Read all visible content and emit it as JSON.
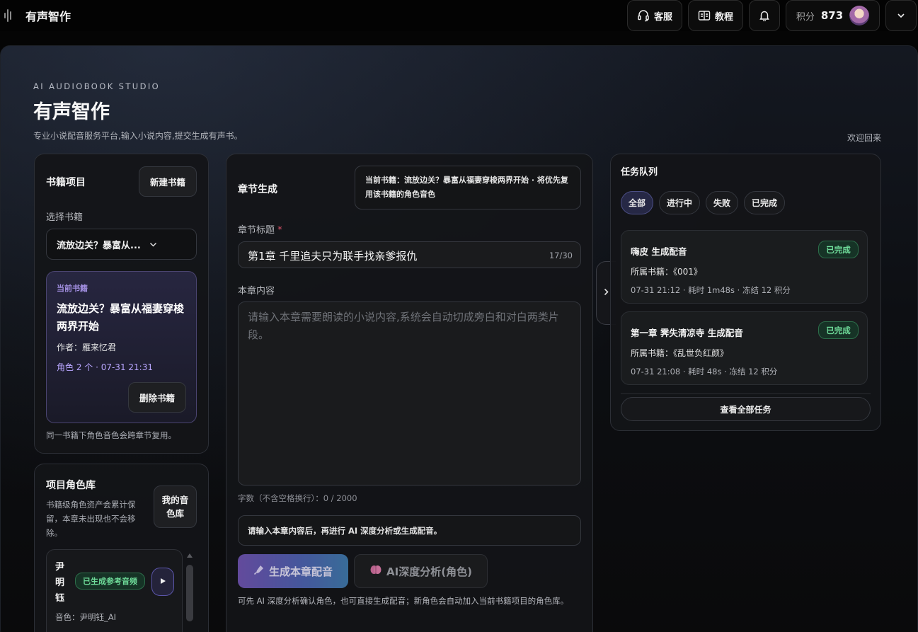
{
  "topbar": {
    "title": "有声智作",
    "service_label": "客服",
    "tutorial_label": "教程",
    "points_label": "积分",
    "points_value": "873"
  },
  "hero": {
    "eyebrow": "AI AUDIOBOOK STUDIO",
    "title": "有声智作",
    "subtitle": "专业小说配音服务平台,输入小说内容,提交生成有声书。",
    "welcome": "欢迎回来"
  },
  "books": {
    "heading": "书籍项目",
    "new_button": "新建书籍",
    "select_label": "选择书籍",
    "selected_value": "流放边关？暴富从...",
    "current": {
      "tag": "当前书籍",
      "name": "流放边关？暴富从福妻穿梭两界开始",
      "author": "作者：雁来忆君",
      "meta": "角色 2 个 · 07-31 21:31",
      "delete_button": "删除书籍"
    },
    "note": "同一书籍下角色音色会跨章节复用。"
  },
  "roles": {
    "heading": "项目角色库",
    "description": "书籍级角色资产会累计保留，本章未出现也不会移除。",
    "my_voices_button": "我的音色库",
    "items": [
      {
        "name": "尹明钰",
        "badge": "已生成参考音频",
        "voice": "音色：尹明钰_AI"
      }
    ]
  },
  "chapter": {
    "heading": "章节生成",
    "info": "当前书籍：流放边关？暴富从福妻穿梭两界开始 · 将优先复用该书籍的角色音色",
    "title_label": "章节标题",
    "required_mark": "*",
    "title_value": "第1章 千里追夫只为联手找亲爹报仇",
    "title_count": "17/30",
    "content_label": "本章内容",
    "content_placeholder": "请输入本章需要朗读的小说内容,系统会自动切成旁白和对白两类片段。",
    "char_count": "字数（不含空格换行）：0 / 2000",
    "hint": "请输入本章内容后，再进行 AI 深度分析或生成配音。",
    "generate_button": "生成本章配音",
    "analyze_button": "AI深度分析(角色)",
    "footer_note": "可先 AI 深度分析确认角色，也可直接生成配音；新角色会自动加入当前书籍项目的角色库。"
  },
  "tasks": {
    "heading": "任务队列",
    "filters": [
      "全部",
      "进行中",
      "失败",
      "已完成"
    ],
    "active_filter": "全部",
    "items": [
      {
        "title": "嗨皮 生成配音",
        "status": "已完成",
        "book": "所属书籍：《001》",
        "meta": "07-31 21:12 · 耗时 1m48s · 冻结 12 积分"
      },
      {
        "title": "第一章 霁失清凉寺 生成配音",
        "status": "已完成",
        "book": "所属书籍：《乱世负红颜》",
        "meta": "07-31 21:08 · 耗时 48s · 冻结 12 积分"
      }
    ],
    "view_all_button": "查看全部任务"
  },
  "icons": {
    "brand": "audio-wave-icon",
    "service": "headset-icon",
    "tutorial": "book-icon",
    "notification": "bell-icon",
    "menu": "chevron-down-icon",
    "generate": "microphone-icon",
    "analyze": "brain-icon",
    "play": "play-icon",
    "collapse": "chevron-right-icon"
  },
  "colors": {
    "accent_purple": "#6a4fa8",
    "status_green": "#6fdc9a",
    "required_red": "#e0556b"
  }
}
